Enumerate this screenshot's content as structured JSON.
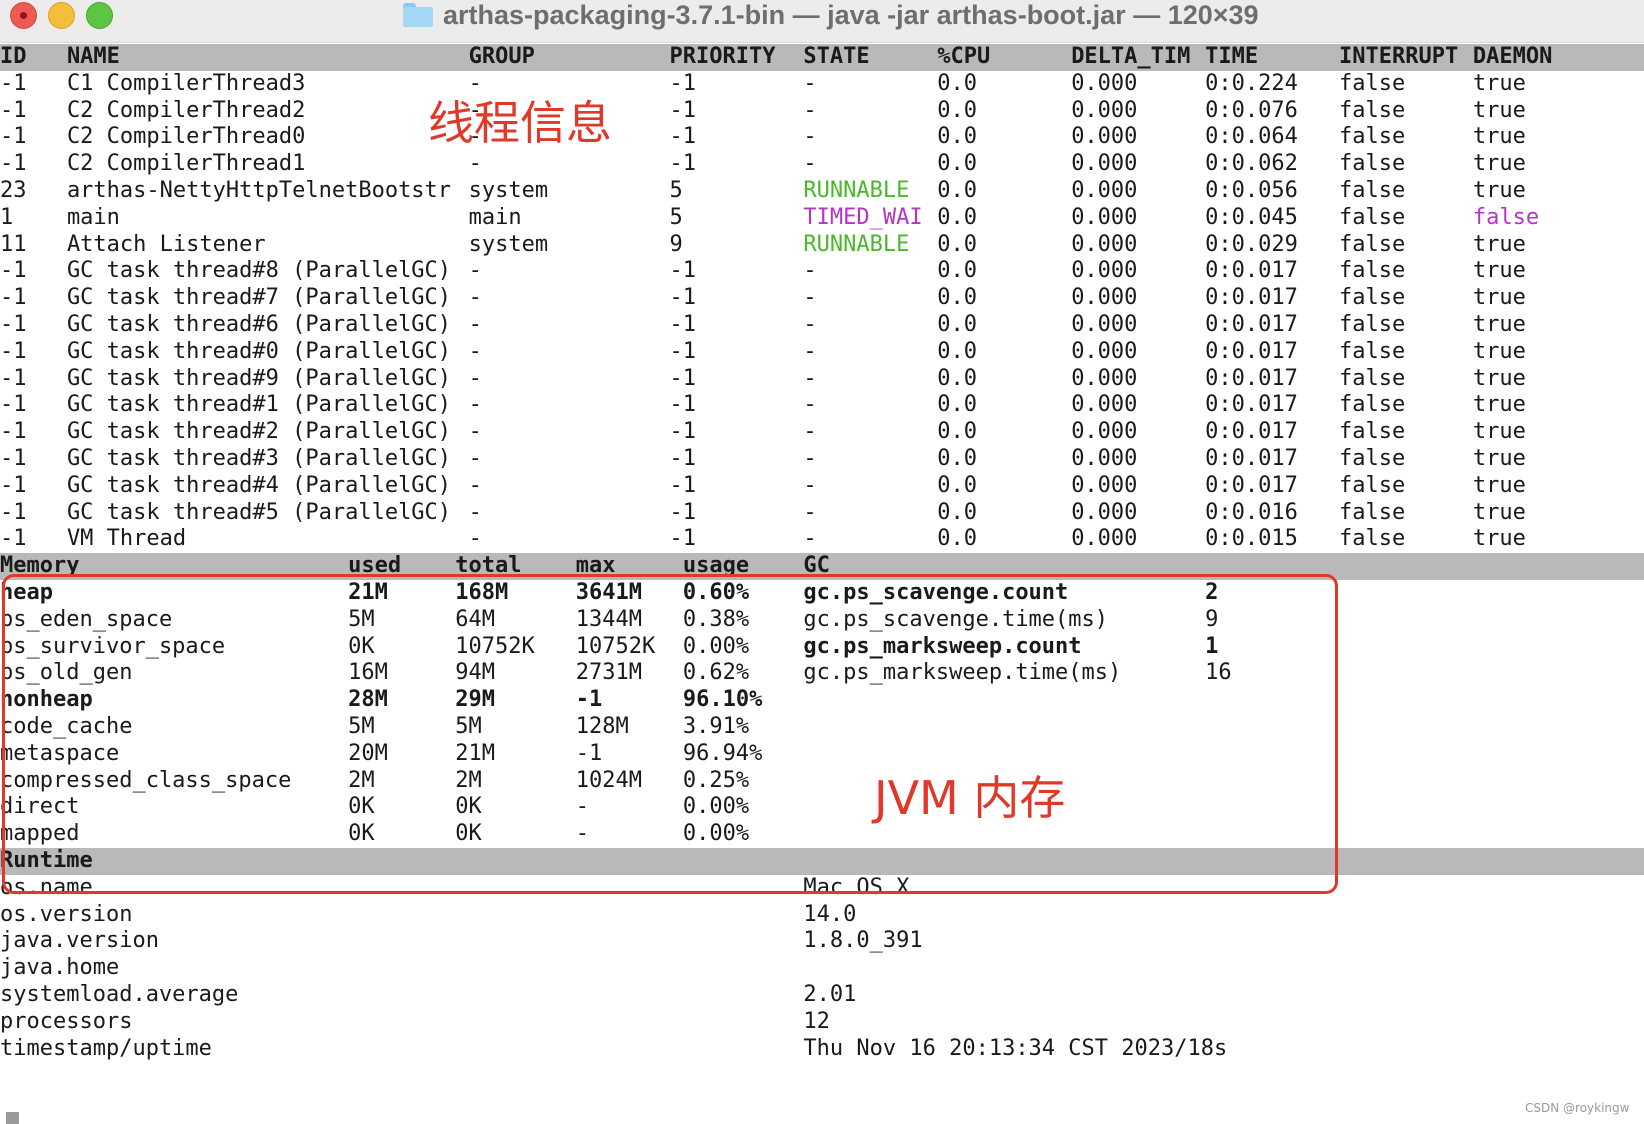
{
  "window": {
    "title": "arthas-packaging-3.7.1-bin — java -jar arthas-boot.jar — 120×39",
    "icon": "folder-icon",
    "traffic_lights": {
      "close": "#ee5b52",
      "minimize": "#f6bd3a",
      "maximize": "#5ec444"
    }
  },
  "colors": {
    "header_bg": "#b9b9b9",
    "runnable": "#49b82b",
    "timed_waiting": "#b535c8",
    "annotation": "#e0392a"
  },
  "threads": {
    "columns": [
      "ID",
      "NAME",
      "GROUP",
      "PRIORITY",
      "STATE",
      "%CPU",
      "DELTA_TIM",
      "TIME",
      "INTERRUPT",
      "DAEMON"
    ],
    "rows": [
      {
        "id": "-1",
        "name": "C1 CompilerThread3",
        "group": "-",
        "priority": "-1",
        "state": "-",
        "cpu": "0.0",
        "delta": "0.000",
        "time": "0:0.224",
        "interrupt": "false",
        "daemon": "true"
      },
      {
        "id": "-1",
        "name": "C2 CompilerThread2",
        "group": "-",
        "priority": "-1",
        "state": "-",
        "cpu": "0.0",
        "delta": "0.000",
        "time": "0:0.076",
        "interrupt": "false",
        "daemon": "true"
      },
      {
        "id": "-1",
        "name": "C2 CompilerThread0",
        "group": "-",
        "priority": "-1",
        "state": "-",
        "cpu": "0.0",
        "delta": "0.000",
        "time": "0:0.064",
        "interrupt": "false",
        "daemon": "true"
      },
      {
        "id": "-1",
        "name": "C2 CompilerThread1",
        "group": "-",
        "priority": "-1",
        "state": "-",
        "cpu": "0.0",
        "delta": "0.000",
        "time": "0:0.062",
        "interrupt": "false",
        "daemon": "true"
      },
      {
        "id": "23",
        "name": "arthas-NettyHttpTelnetBootstr",
        "group": "system",
        "priority": "5",
        "state": "RUNNABLE",
        "cpu": "0.0",
        "delta": "0.000",
        "time": "0:0.056",
        "interrupt": "false",
        "daemon": "true"
      },
      {
        "id": "1",
        "name": "main",
        "group": "main",
        "priority": "5",
        "state": "TIMED_WAI",
        "cpu": "0.0",
        "delta": "0.000",
        "time": "0:0.045",
        "interrupt": "false",
        "daemon": "false"
      },
      {
        "id": "11",
        "name": "Attach Listener",
        "group": "system",
        "priority": "9",
        "state": "RUNNABLE",
        "cpu": "0.0",
        "delta": "0.000",
        "time": "0:0.029",
        "interrupt": "false",
        "daemon": "true"
      },
      {
        "id": "-1",
        "name": "GC task thread#8 (ParallelGC)",
        "group": "-",
        "priority": "-1",
        "state": "-",
        "cpu": "0.0",
        "delta": "0.000",
        "time": "0:0.017",
        "interrupt": "false",
        "daemon": "true"
      },
      {
        "id": "-1",
        "name": "GC task thread#7 (ParallelGC)",
        "group": "-",
        "priority": "-1",
        "state": "-",
        "cpu": "0.0",
        "delta": "0.000",
        "time": "0:0.017",
        "interrupt": "false",
        "daemon": "true"
      },
      {
        "id": "-1",
        "name": "GC task thread#6 (ParallelGC)",
        "group": "-",
        "priority": "-1",
        "state": "-",
        "cpu": "0.0",
        "delta": "0.000",
        "time": "0:0.017",
        "interrupt": "false",
        "daemon": "true"
      },
      {
        "id": "-1",
        "name": "GC task thread#0 (ParallelGC)",
        "group": "-",
        "priority": "-1",
        "state": "-",
        "cpu": "0.0",
        "delta": "0.000",
        "time": "0:0.017",
        "interrupt": "false",
        "daemon": "true"
      },
      {
        "id": "-1",
        "name": "GC task thread#9 (ParallelGC)",
        "group": "-",
        "priority": "-1",
        "state": "-",
        "cpu": "0.0",
        "delta": "0.000",
        "time": "0:0.017",
        "interrupt": "false",
        "daemon": "true"
      },
      {
        "id": "-1",
        "name": "GC task thread#1 (ParallelGC)",
        "group": "-",
        "priority": "-1",
        "state": "-",
        "cpu": "0.0",
        "delta": "0.000",
        "time": "0:0.017",
        "interrupt": "false",
        "daemon": "true"
      },
      {
        "id": "-1",
        "name": "GC task thread#2 (ParallelGC)",
        "group": "-",
        "priority": "-1",
        "state": "-",
        "cpu": "0.0",
        "delta": "0.000",
        "time": "0:0.017",
        "interrupt": "false",
        "daemon": "true"
      },
      {
        "id": "-1",
        "name": "GC task thread#3 (ParallelGC)",
        "group": "-",
        "priority": "-1",
        "state": "-",
        "cpu": "0.0",
        "delta": "0.000",
        "time": "0:0.017",
        "interrupt": "false",
        "daemon": "true"
      },
      {
        "id": "-1",
        "name": "GC task thread#4 (ParallelGC)",
        "group": "-",
        "priority": "-1",
        "state": "-",
        "cpu": "0.0",
        "delta": "0.000",
        "time": "0:0.017",
        "interrupt": "false",
        "daemon": "true"
      },
      {
        "id": "-1",
        "name": "GC task thread#5 (ParallelGC)",
        "group": "-",
        "priority": "-1",
        "state": "-",
        "cpu": "0.0",
        "delta": "0.000",
        "time": "0:0.016",
        "interrupt": "false",
        "daemon": "true"
      },
      {
        "id": "-1",
        "name": "VM Thread",
        "group": "-",
        "priority": "-1",
        "state": "-",
        "cpu": "0.0",
        "delta": "0.000",
        "time": "0:0.015",
        "interrupt": "false",
        "daemon": "true"
      }
    ]
  },
  "memory": {
    "columns": [
      "Memory",
      "used",
      "total",
      "max",
      "usage",
      "GC"
    ],
    "rows": [
      {
        "name": "heap",
        "used": "21M",
        "total": "168M",
        "max": "3641M",
        "usage": "0.60%",
        "bold": true,
        "gc_key": "gc.ps_scavenge.count",
        "gc_val": "2",
        "gc_bold": true
      },
      {
        "name": "ps_eden_space",
        "used": "5M",
        "total": "64M",
        "max": "1344M",
        "usage": "0.38%",
        "bold": false,
        "gc_key": "gc.ps_scavenge.time(ms)",
        "gc_val": "9",
        "gc_bold": false
      },
      {
        "name": "ps_survivor_space",
        "used": "0K",
        "total": "10752K",
        "max": "10752K",
        "usage": "0.00%",
        "bold": false,
        "gc_key": "gc.ps_marksweep.count",
        "gc_val": "1",
        "gc_bold": true
      },
      {
        "name": "ps_old_gen",
        "used": "16M",
        "total": "94M",
        "max": "2731M",
        "usage": "0.62%",
        "bold": false,
        "gc_key": "gc.ps_marksweep.time(ms)",
        "gc_val": "16",
        "gc_bold": false
      },
      {
        "name": "nonheap",
        "used": "28M",
        "total": "29M",
        "max": "-1",
        "usage": "96.10%",
        "bold": true,
        "gc_key": "",
        "gc_val": "",
        "gc_bold": false
      },
      {
        "name": "code_cache",
        "used": "5M",
        "total": "5M",
        "max": "128M",
        "usage": "3.91%",
        "bold": false,
        "gc_key": "",
        "gc_val": "",
        "gc_bold": false
      },
      {
        "name": "metaspace",
        "used": "20M",
        "total": "21M",
        "max": "-1",
        "usage": "96.94%",
        "bold": false,
        "gc_key": "",
        "gc_val": "",
        "gc_bold": false
      },
      {
        "name": "compressed_class_space",
        "used": "2M",
        "total": "2M",
        "max": "1024M",
        "usage": "0.25%",
        "bold": false,
        "gc_key": "",
        "gc_val": "",
        "gc_bold": false
      },
      {
        "name": "direct",
        "used": "0K",
        "total": "0K",
        "max": "-",
        "usage": "0.00%",
        "bold": false,
        "gc_key": "",
        "gc_val": "",
        "gc_bold": false
      },
      {
        "name": "mapped",
        "used": "0K",
        "total": "0K",
        "max": "-",
        "usage": "0.00%",
        "bold": false,
        "gc_key": "",
        "gc_val": "",
        "gc_bold": false
      }
    ]
  },
  "runtime": {
    "header": "Runtime",
    "rows": [
      {
        "key": "os.name",
        "value": "Mac OS X"
      },
      {
        "key": "os.version",
        "value": "14.0"
      },
      {
        "key": "java.version",
        "value": "1.8.0_391"
      },
      {
        "key": "java.home",
        "value": ""
      },
      {
        "key": "systemload.average",
        "value": "2.01"
      },
      {
        "key": "processors",
        "value": "12"
      },
      {
        "key": "timestamp/uptime",
        "value": "Thu Nov 16 20:13:34 CST 2023/18s"
      }
    ]
  },
  "annotations": {
    "threads": "线程信息",
    "jvm": "JVM 内存"
  },
  "watermark": "CSDN @roykingw"
}
